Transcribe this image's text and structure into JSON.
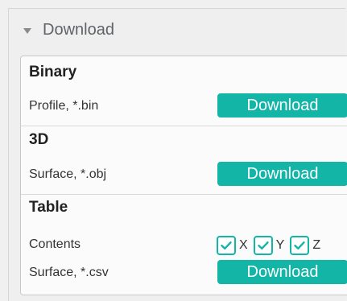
{
  "panel": {
    "header_label": "Download"
  },
  "sections": [
    {
      "title": "Binary",
      "row_label": "Profile, *.bin",
      "button_label": "Download"
    },
    {
      "title": "3D",
      "row_label": "Surface, *.obj",
      "button_label": "Download"
    },
    {
      "title": "Table",
      "contents_label": "Contents",
      "checkboxes": [
        {
          "label": "X",
          "checked": true
        },
        {
          "label": "Y",
          "checked": true
        },
        {
          "label": "Z",
          "checked": true
        }
      ],
      "row_label": "Surface, *.csv",
      "button_label": "Download"
    }
  ],
  "colors": {
    "accent": "#12b5a6"
  },
  "icons": {
    "header": "triangle-down-icon",
    "checkbox": "check-icon"
  }
}
